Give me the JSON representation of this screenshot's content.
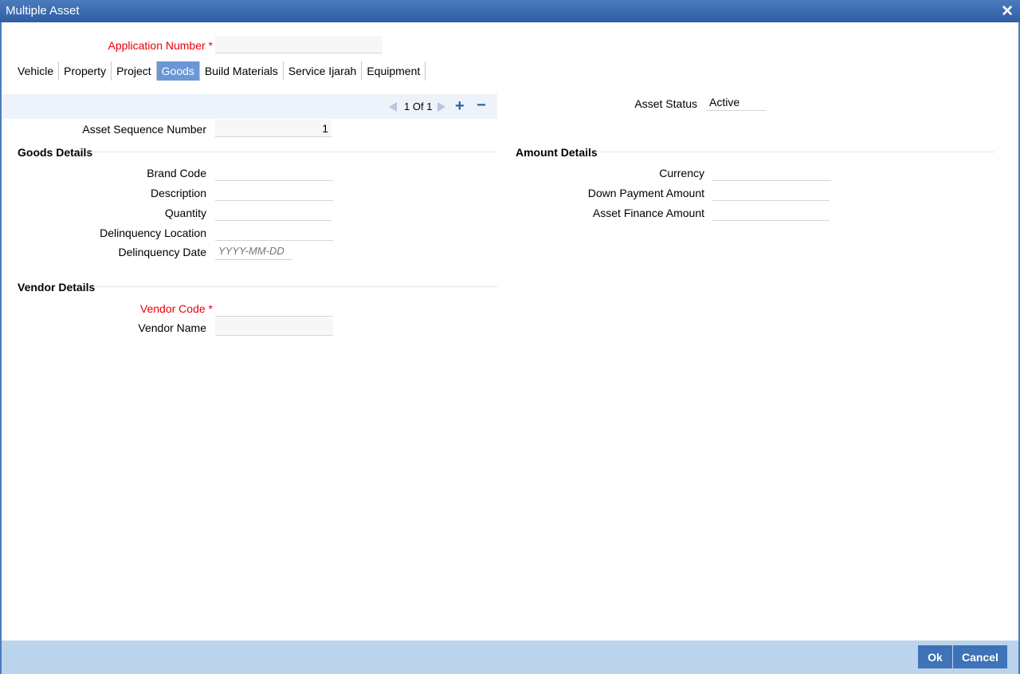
{
  "window": {
    "title": "Multiple Asset",
    "close_symbol": "✕"
  },
  "application": {
    "label": "Application Number",
    "required_mark": "*",
    "value": ""
  },
  "tabs": [
    {
      "label": "Vehicle"
    },
    {
      "label": "Property"
    },
    {
      "label": "Project"
    },
    {
      "label": "Goods",
      "active": true
    },
    {
      "label": "Build Materials"
    },
    {
      "label": "Service Ijarah"
    },
    {
      "label": "Equipment"
    }
  ],
  "navigator": {
    "current": "1",
    "of_label": "Of",
    "total": "1",
    "add_symbol": "+",
    "remove_symbol": "−"
  },
  "asset_status": {
    "label": "Asset Status",
    "value": "Active"
  },
  "asset_sequence": {
    "label": "Asset Sequence Number",
    "value": "1"
  },
  "goods_details": {
    "heading": "Goods Details",
    "brand_code": {
      "label": "Brand Code",
      "value": ""
    },
    "description": {
      "label": "Description",
      "value": ""
    },
    "quantity": {
      "label": "Quantity",
      "value": ""
    },
    "delinquency_location": {
      "label": "Delinquency Location",
      "value": ""
    },
    "delinquency_date": {
      "label": "Delinquency Date",
      "placeholder": "YYYY-MM-DD"
    }
  },
  "amount_details": {
    "heading": "Amount Details",
    "currency": {
      "label": "Currency",
      "value": ""
    },
    "down_payment": {
      "label": "Down Payment Amount",
      "value": ""
    },
    "asset_finance": {
      "label": "Asset Finance Amount",
      "value": ""
    }
  },
  "vendor_details": {
    "heading": "Vendor Details",
    "vendor_code": {
      "label": "Vendor Code",
      "required_mark": "*",
      "value": ""
    },
    "vendor_name": {
      "label": "Vendor Name",
      "value": ""
    }
  },
  "footer": {
    "ok_label": "Ok",
    "cancel_label": "Cancel"
  },
  "colors": {
    "titlebar": "#2f5fa3",
    "required": "#e8000b",
    "active_tab": "#6a97d6",
    "button": "#3e73b8",
    "footer": "#bcd3ec"
  }
}
